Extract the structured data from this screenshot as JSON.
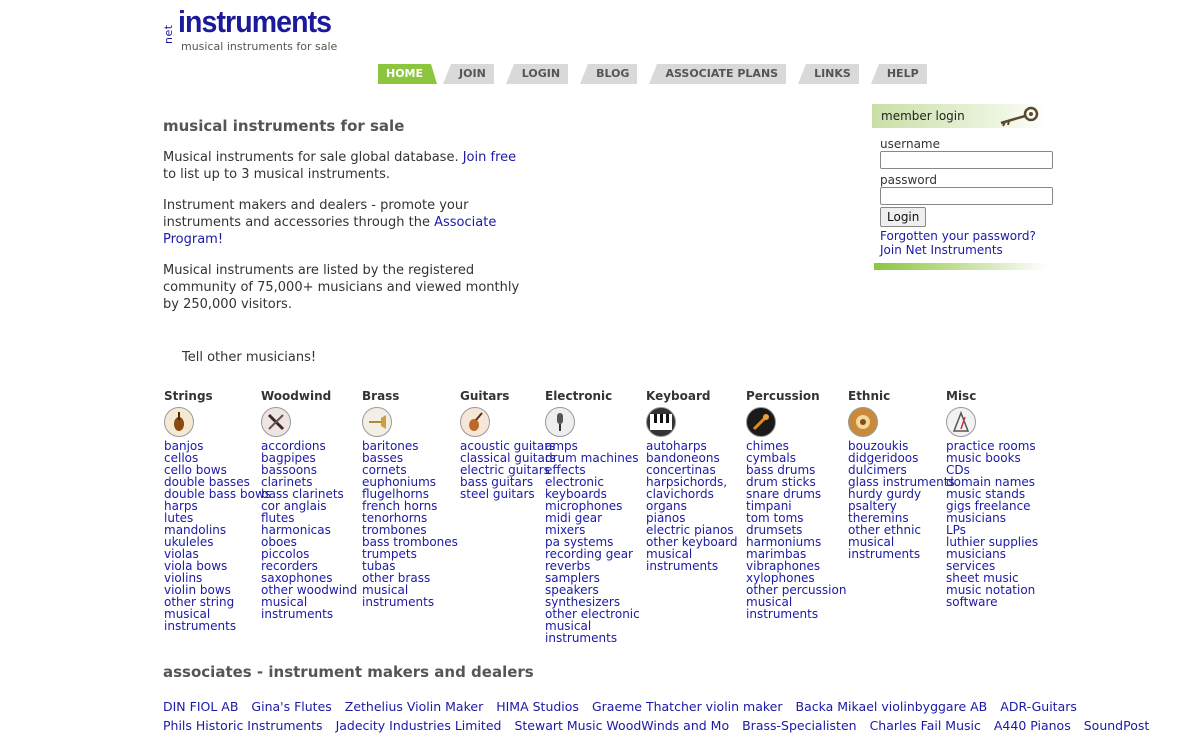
{
  "logo": {
    "net": "net",
    "brand": "instruments",
    "tagline": "musical instruments for sale"
  },
  "nav": [
    "HOME",
    "JOIN",
    "LOGIN",
    "BLOG",
    "ASSOCIATE PLANS",
    "LINKS",
    "HELP"
  ],
  "intro": {
    "title": "musical instruments for sale",
    "p1_a": "Musical instruments for sale global database. ",
    "p1_link": "Join free",
    "p1_b": " to list up to 3 musical instruments.",
    "p2_a": "Instrument makers and dealers - promote your instruments and accessories through the ",
    "p2_link": "Associate Program!",
    "p3": "Musical instruments are listed by the registered community of 75,000+ musicians and viewed monthly by 250,000 visitors.",
    "tell": "Tell other musicians!"
  },
  "login": {
    "header": "member login",
    "username_label": "username",
    "password_label": "password",
    "button": "Login",
    "forgot": "Forgotten your password?",
    "join": "Join Net Instruments"
  },
  "categories": [
    {
      "name": "Strings",
      "icon": "violin-icon",
      "items": [
        "banjos",
        "cellos",
        "cello bows",
        "double basses",
        "double bass bows",
        "harps",
        "lutes",
        "mandolins",
        "ukuleles",
        "violas",
        "viola bows",
        "violins",
        "violin bows",
        "other string",
        "musical",
        "instruments"
      ]
    },
    {
      "name": "Woodwind",
      "icon": "clarinet-icon",
      "items": [
        "accordions",
        "bagpipes",
        "bassoons",
        "clarinets",
        "bass clarinets",
        "cor anglais",
        "flutes",
        "harmonicas",
        "oboes",
        "piccolos",
        "recorders",
        "saxophones",
        "other woodwind",
        "musical",
        "instruments"
      ]
    },
    {
      "name": "Brass",
      "icon": "trumpet-icon",
      "items": [
        "baritones",
        "basses",
        "cornets",
        "euphoniums",
        "flugelhorns",
        "french horns",
        "tenorhorns",
        "trombones",
        "bass trombones",
        "trumpets",
        "tubas",
        "other brass",
        "musical",
        "instruments"
      ]
    },
    {
      "name": "Guitars",
      "icon": "guitar-icon",
      "items": [
        "acoustic guitars",
        "classical guitars",
        "electric guitars",
        "bass guitars",
        "steel guitars"
      ]
    },
    {
      "name": "Electronic",
      "icon": "microphone-icon",
      "items": [
        "amps",
        "drum machines",
        "effects",
        "electronic",
        "keyboards",
        "microphones",
        "midi gear",
        "mixers",
        "pa systems",
        "recording gear",
        "reverbs",
        "samplers",
        "speakers",
        "synthesizers",
        "other electronic",
        "musical",
        "instruments"
      ]
    },
    {
      "name": "Keyboard",
      "icon": "piano-keys-icon",
      "items": [
        "autoharps",
        "bandoneons",
        "concertinas",
        "harpsichords,",
        "clavichords",
        "organs",
        "pianos",
        "electric pianos",
        "other keyboard",
        "musical",
        "instruments"
      ]
    },
    {
      "name": "Percussion",
      "icon": "drumstick-icon",
      "items": [
        "chimes",
        "cymbals",
        "bass drums",
        "drum sticks",
        "snare drums",
        "timpani",
        "tom toms",
        "drumsets",
        "harmoniums",
        "marimbas",
        "vibraphones",
        "xylophones",
        "other percussion",
        "musical",
        "instruments"
      ]
    },
    {
      "name": "Ethnic",
      "icon": "ethnic-drum-icon",
      "items": [
        "bouzoukis",
        "didgeridoos",
        "dulcimers",
        "glass instruments",
        "hurdy gurdy",
        "psaltery",
        "theremins",
        "other ethnic",
        "musical",
        "instruments"
      ]
    },
    {
      "name": "Misc",
      "icon": "metronome-icon",
      "items": [
        "practice rooms",
        "music books",
        "CDs",
        "domain names",
        "music stands",
        "gigs freelance",
        "musicians",
        "LPs",
        "luthier supplies",
        "musicians",
        "services",
        "sheet music",
        "music notation",
        "software"
      ]
    }
  ],
  "associates": {
    "title": "associates - instrument makers and dealers",
    "row1": [
      "DIN FIOL AB",
      "Gina's Flutes",
      "Zethelius Violin Maker",
      "HIMA Studios",
      "Graeme Thatcher violin maker",
      "Backa Mikael violinbyggare AB",
      "ADR-Guitars"
    ],
    "row2": [
      "Phils Historic Instruments",
      "Jadecity Industries Limited",
      "Stewart Music WoodWinds and Mo",
      "Brass-Specialisten",
      "Charles Fail Music",
      "A440 Pianos",
      "SoundPost"
    ]
  },
  "colors": {
    "accent_green": "#8cc63e",
    "link_blue": "#1a1aa6",
    "brand_blue": "#1a1a9a"
  }
}
